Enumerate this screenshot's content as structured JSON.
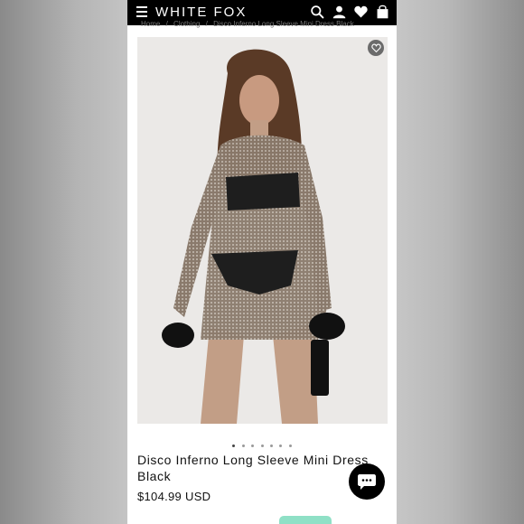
{
  "header": {
    "brand": "WHITE FOX",
    "menu_icon": "hamburger-menu-icon",
    "search_icon": "search-icon",
    "account_icon": "user-icon",
    "wishlist_icon": "heart-icon",
    "bag_icon": "shopping-bag-icon"
  },
  "breadcrumb": {
    "items": [
      "Home",
      "/",
      "Clothing",
      "/",
      "Disco Inferno Long Sleeve Mini Dress Black"
    ]
  },
  "gallery": {
    "wishlist_icon": "heart-outline-icon",
    "dot_count": 7,
    "active_dot": 0
  },
  "product": {
    "title": "Disco Inferno Long Sleeve Mini Dress Black",
    "price": "$104.99 USD"
  },
  "chat": {
    "icon": "chat-bubble-icon"
  },
  "colors": {
    "header_bg": "#000000",
    "chat_bg": "#000000",
    "accent_teal": "#8fe0c6"
  }
}
